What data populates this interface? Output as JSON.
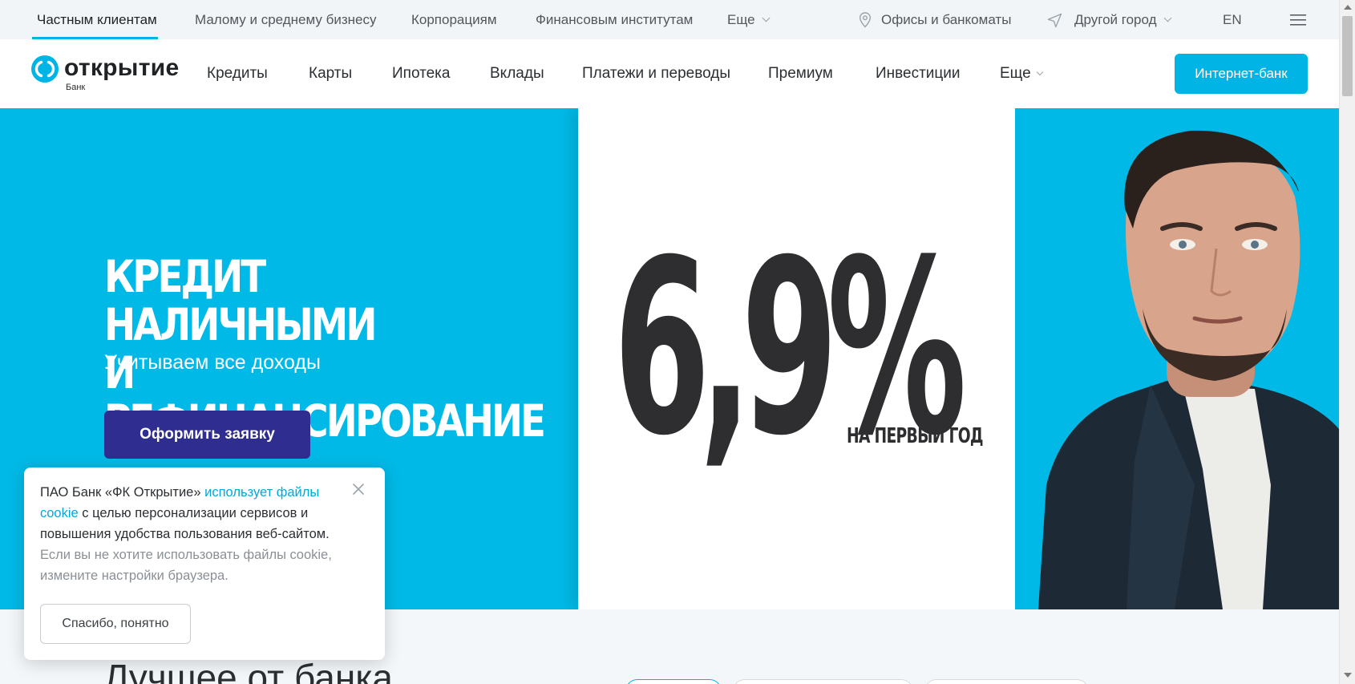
{
  "topbar": {
    "segments": [
      {
        "label": "Частным клиентам",
        "active": true
      },
      {
        "label": "Малому и среднему бизнесу"
      },
      {
        "label": "Корпорациям"
      },
      {
        "label": "Финансовым институтам"
      },
      {
        "label": "Еще"
      }
    ],
    "offices_label": "Офисы и банкоматы",
    "city_label": "Другой город",
    "lang_label": "EN"
  },
  "header": {
    "logo_word": "открытие",
    "logo_sub": "Банк",
    "nav": [
      "Кредиты",
      "Карты",
      "Ипотека",
      "Вклады",
      "Платежи и переводы",
      "Премиум",
      "Инвестиции",
      "Еще"
    ],
    "internet_bank_label": "Интернет-банк"
  },
  "hero": {
    "title_line1": "КРЕДИТ НАЛИЧНЫМИ",
    "title_line2": "И РЕФИНАНСИРОВАНИЕ",
    "subtitle": "Учитываем все доходы",
    "cta_label": "Оформить заявку",
    "rate": "6,9%",
    "rate_note": "НА ПЕРВЫЙ ГОД"
  },
  "cookie": {
    "text_part1": "ПАО Банк «ФК Открытие» ",
    "link": "использует файлы cookie",
    "text_part2": " с целью персонализации сервисов и повышения удобства пользования веб-сайтом.",
    "muted": "Если вы не хотите использовать файлы cookie, измените настройки браузера.",
    "button_label": "Спасибо, понятно"
  },
  "section": {
    "title": "Лучшее от банка"
  },
  "colors": {
    "accent": "#00b4e6",
    "hero_bg": "#00b9e6",
    "cta_bg": "#2f2d8f"
  },
  "icons": [
    "location-pin-icon",
    "navigation-arrow-icon",
    "menu-icon",
    "close-icon",
    "chevron-down-icon"
  ]
}
